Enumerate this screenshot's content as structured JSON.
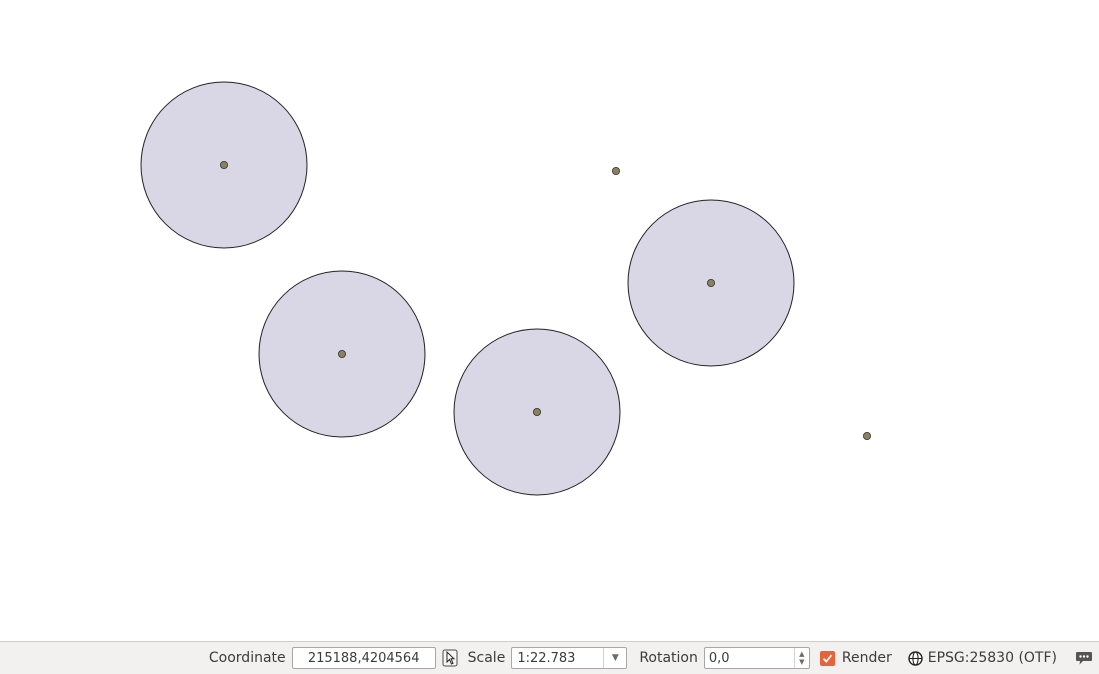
{
  "map": {
    "background": "#ffffff",
    "buffer_fill": "#d9d7e6",
    "buffer_stroke": "#222222",
    "point_fill": "#8a825e",
    "point_stroke": "#333333"
  },
  "statusbar": {
    "coordinate_label": "Coordinate",
    "coordinate_value": "215188,4204564",
    "scale_label": "Scale",
    "scale_value": "1:22.783",
    "rotation_label": "Rotation",
    "rotation_value": "0,0",
    "render_label": "Render",
    "render_checked": true,
    "crs_label": "EPSG:25830 (OTF)"
  },
  "icons": {
    "coordinate_toggle": "mouse-pointer-icon",
    "scale_dropdown": "chevron-down-icon",
    "rotation_spinner": "spinner-arrows-icon",
    "crs": "projection-globe-icon",
    "messages": "speech-bubble-icon"
  }
}
